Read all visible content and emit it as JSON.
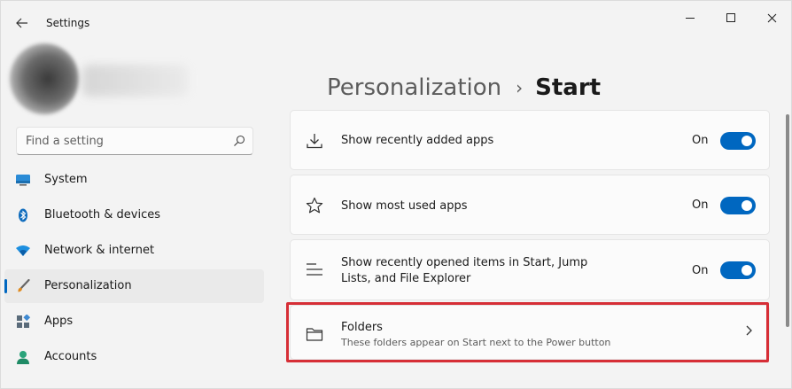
{
  "app": {
    "title": "Settings"
  },
  "search": {
    "placeholder": "Find a setting"
  },
  "sidebar": {
    "items": [
      {
        "label": "System",
        "icon": "monitor-icon"
      },
      {
        "label": "Bluetooth & devices",
        "icon": "bluetooth-icon"
      },
      {
        "label": "Network & internet",
        "icon": "wifi-icon"
      },
      {
        "label": "Personalization",
        "icon": "brush-icon",
        "selected": true
      },
      {
        "label": "Apps",
        "icon": "apps-grid-icon"
      },
      {
        "label": "Accounts",
        "icon": "person-icon"
      }
    ]
  },
  "header": {
    "parent": "Personalization",
    "separator": "›",
    "current": "Start"
  },
  "settings": [
    {
      "label": "Show recently added apps",
      "state": "On",
      "icon": "download-icon"
    },
    {
      "label": "Show most used apps",
      "state": "On",
      "icon": "star-icon"
    },
    {
      "label_line1": "Show recently opened items in Start, Jump",
      "label_line2": "Lists, and File Explorer",
      "state": "On",
      "icon": "list-icon"
    },
    {
      "label": "Folders",
      "description": "These folders appear on Start next to the Power button",
      "icon": "folder-icon"
    }
  ],
  "colors": {
    "accent": "#0067c0",
    "highlight": "#d62e36"
  }
}
